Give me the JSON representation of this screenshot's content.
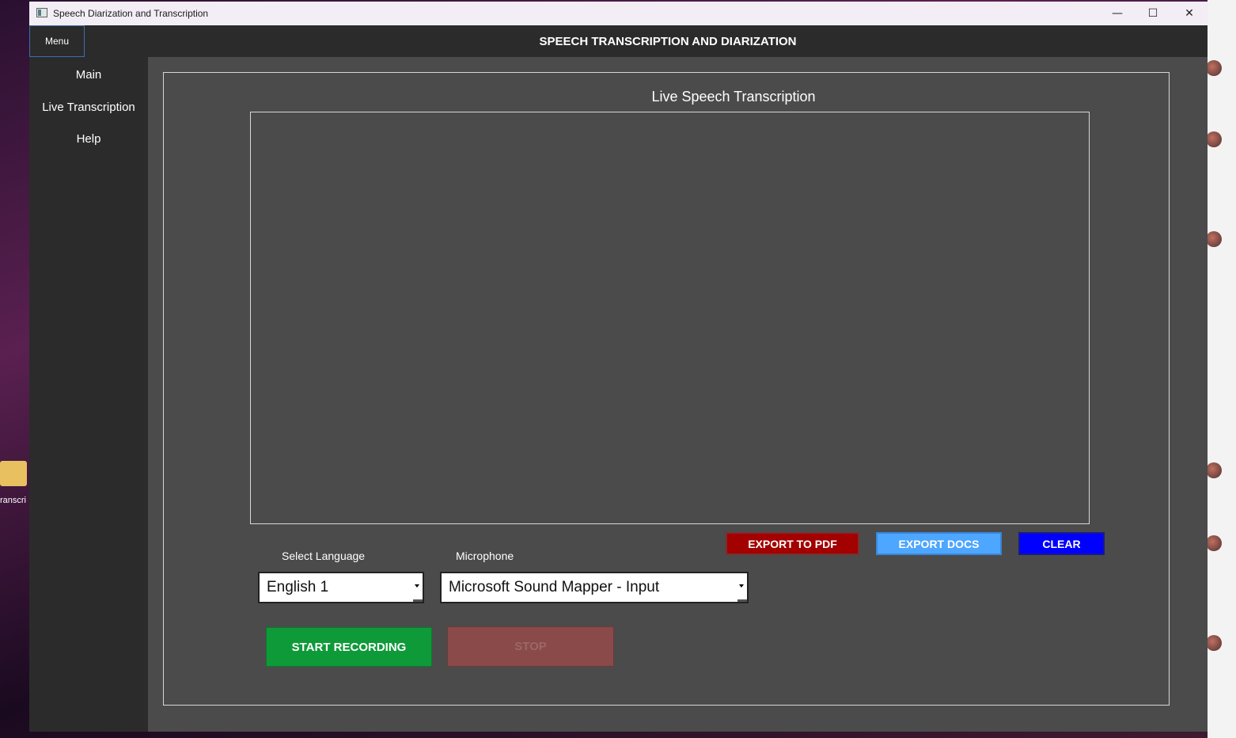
{
  "desktop": {
    "icon_label": "ranscri"
  },
  "window": {
    "title": "Speech Diarization and Transcription",
    "controls": {
      "minimize": "—",
      "maximize": "☐",
      "close": "✕"
    }
  },
  "menubar": {
    "menu_label": "Menu",
    "heading": "SPEECH TRANSCRIPTION AND DIARIZATION"
  },
  "sidebar": {
    "items": [
      {
        "label": "Main"
      },
      {
        "label": "Live Transcription"
      },
      {
        "label": "Help"
      }
    ]
  },
  "main": {
    "section_title": "Live Speech Transcription",
    "transcript_text": "",
    "buttons": {
      "export_pdf": "EXPORT TO PDF",
      "export_docs": "EXPORT  DOCS",
      "clear": "CLEAR",
      "start": "START RECORDING",
      "stop": "STOP"
    },
    "language": {
      "label": "Select Language",
      "value": "English 1"
    },
    "microphone": {
      "label": "Microphone",
      "value": "Microsoft Sound Mapper - Input"
    },
    "colors": {
      "export_pdf": "#a30000",
      "export_docs": "#4da6ff",
      "clear": "#0000ff",
      "start": "#0f9a3a",
      "stop_disabled": "#8a4a4a",
      "panel": "#4b4b4b",
      "sidebar": "#2b2b2b"
    }
  }
}
